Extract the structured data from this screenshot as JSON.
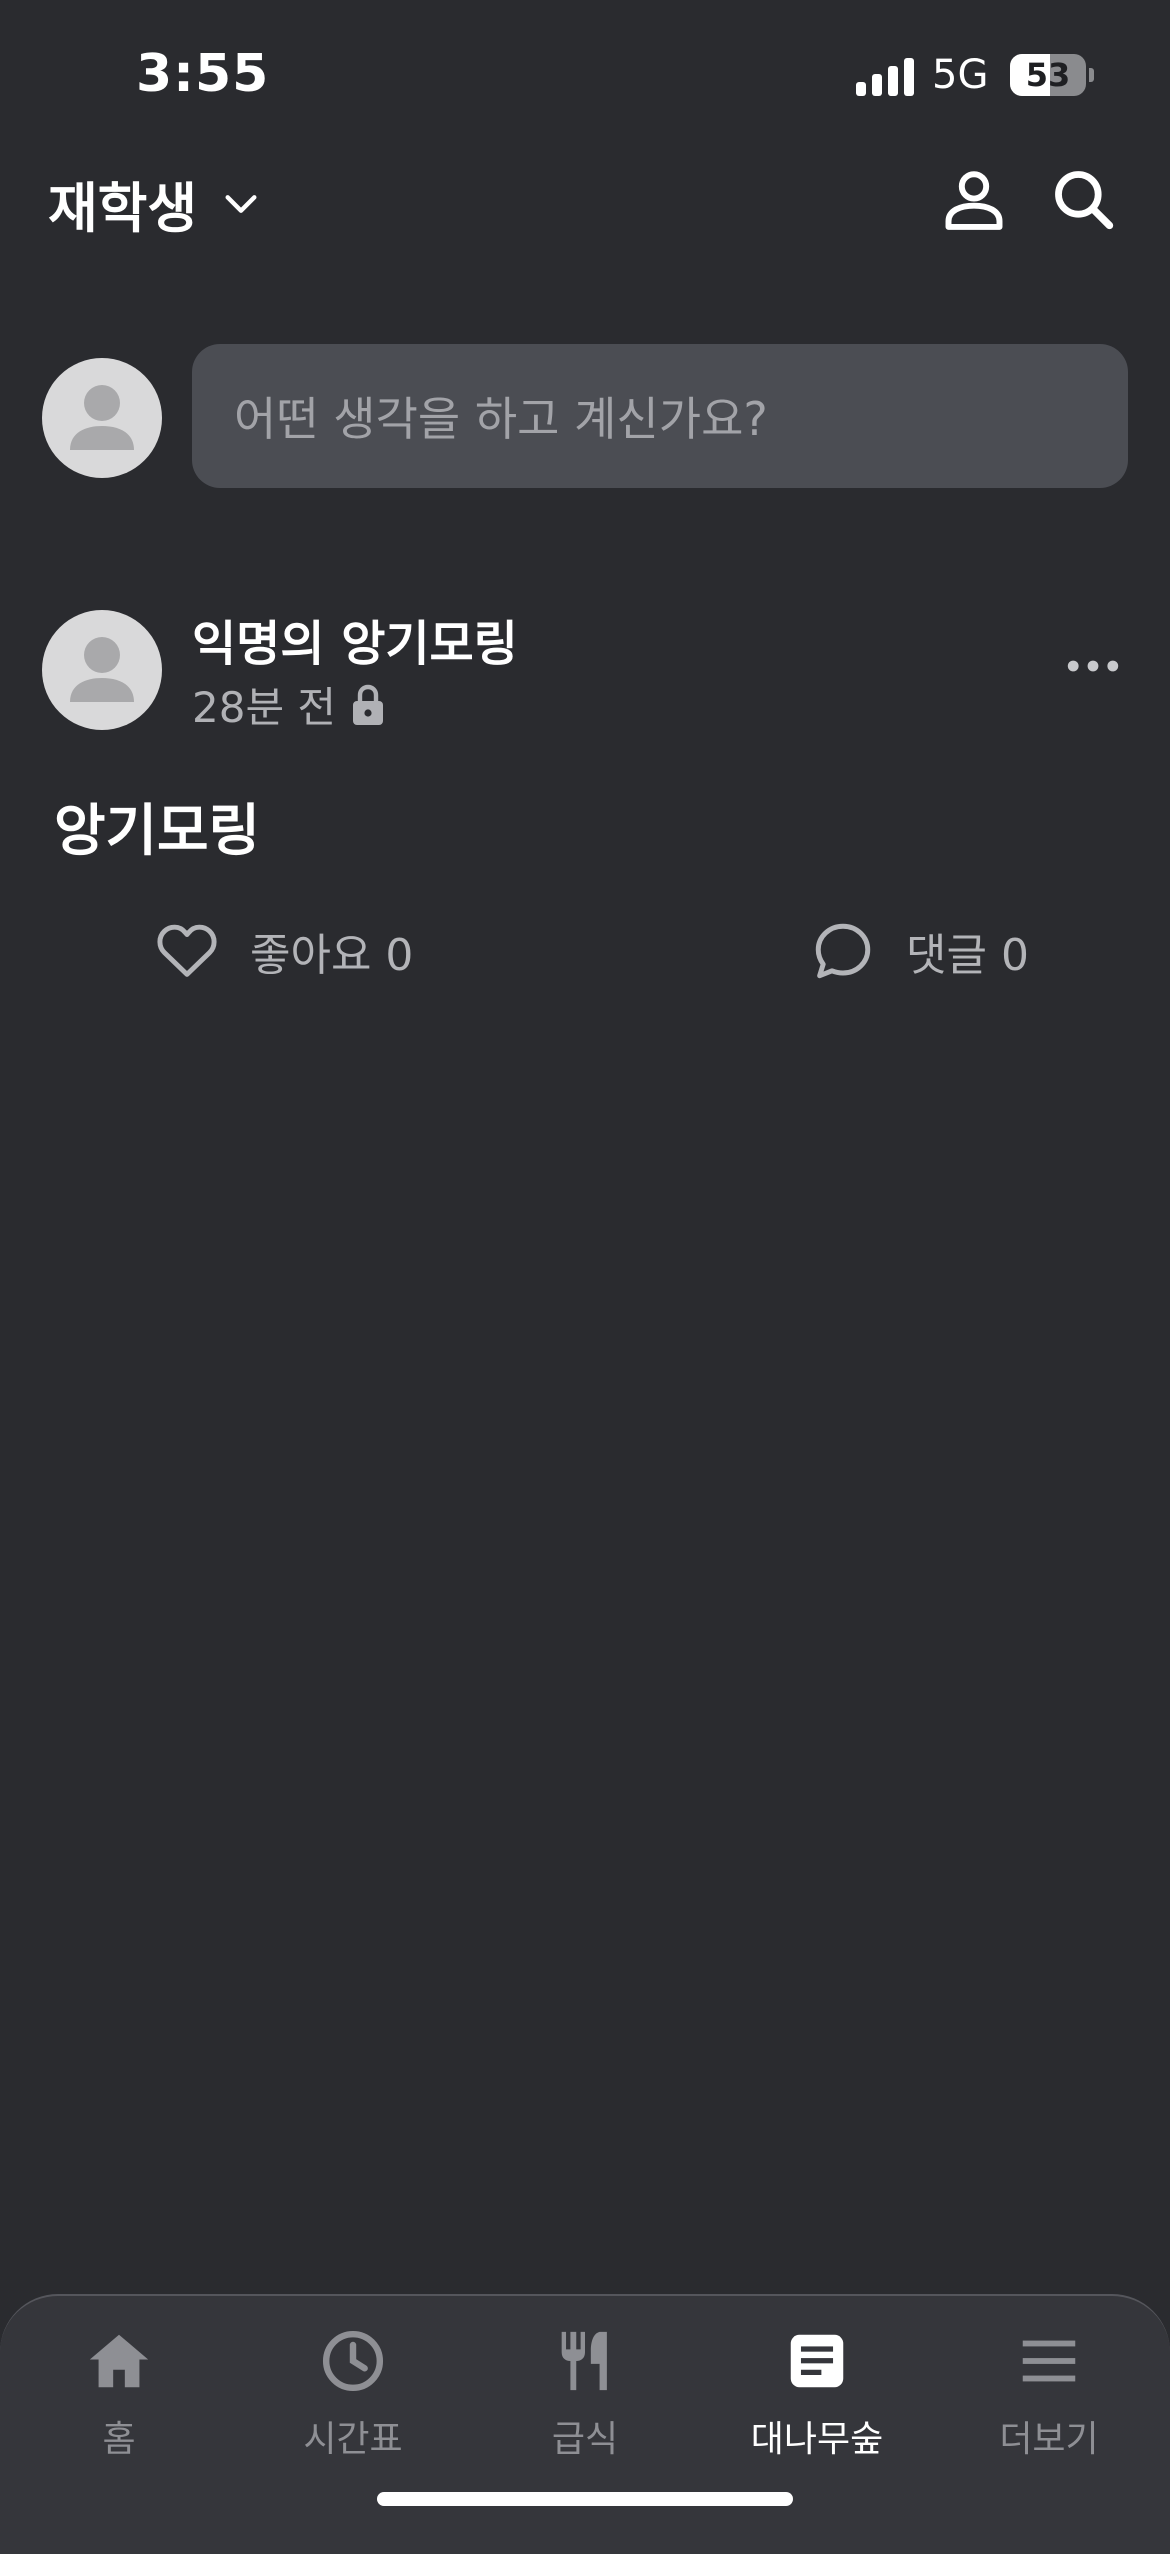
{
  "status_bar": {
    "time": "3:55",
    "network": "5G",
    "battery": "53",
    "battery_level": 0.53
  },
  "header": {
    "title": "재학생"
  },
  "composer": {
    "placeholder": "어떤 생각을 하고 계신가요?"
  },
  "post": {
    "author": "익명의 앙기모링",
    "time_ago": "28분 전",
    "content": "앙기모링",
    "like_label": "좋아요 0",
    "comment_label": "댓글 0"
  },
  "tabbar": {
    "items": [
      {
        "label": "홈",
        "icon": "home-icon"
      },
      {
        "label": "시간표",
        "icon": "clock-icon"
      },
      {
        "label": "급식",
        "icon": "utensils-icon"
      },
      {
        "label": "대나무숲",
        "icon": "document-icon",
        "active": true
      },
      {
        "label": "더보기",
        "icon": "menu-icon"
      }
    ]
  },
  "colors": {
    "background": "#2a2b2f",
    "input": "#4b4d53",
    "tabbar": "#35363b",
    "muted_text": "#b0b1b5"
  }
}
